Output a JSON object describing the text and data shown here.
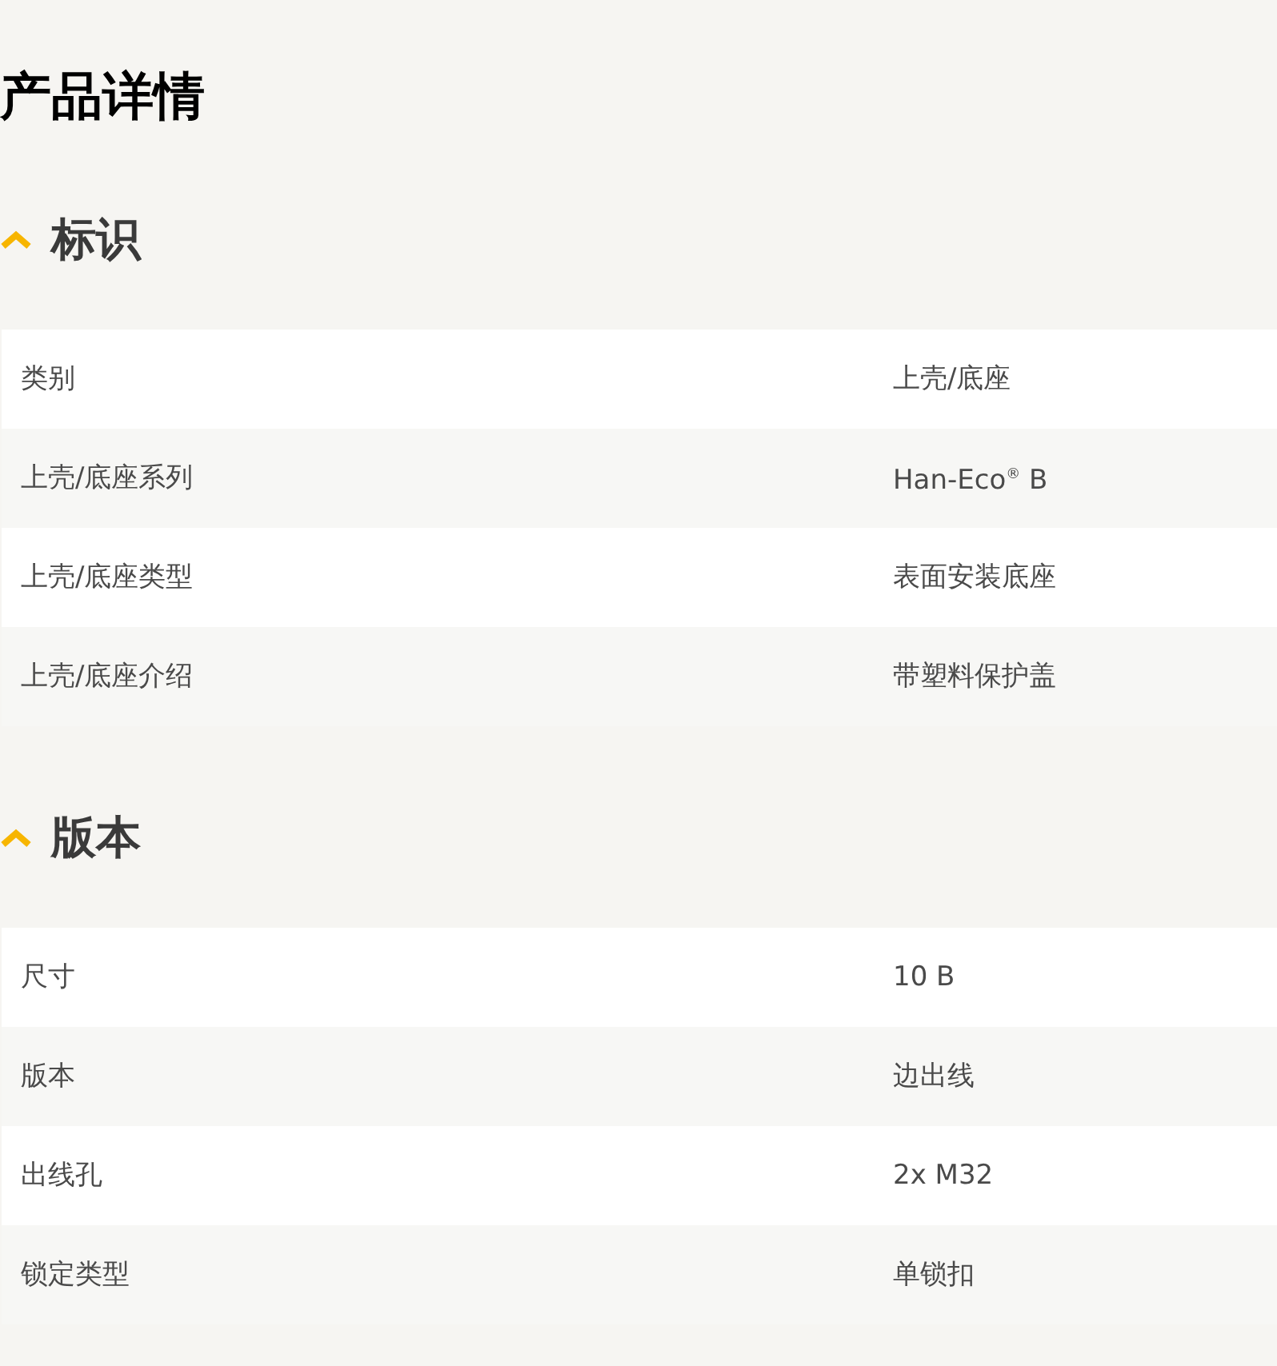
{
  "title": "产品详情",
  "sections": [
    {
      "title": "标识",
      "expanded": true,
      "rows": [
        {
          "label": "类别",
          "value": "上壳/底座"
        },
        {
          "label": "上壳/底座系列",
          "value": "Han-Eco$^{®}$ B"
        },
        {
          "label": "上壳/底座类型",
          "value": "表面安装底座"
        },
        {
          "label": "上壳/底座介绍",
          "value": "带塑料保护盖"
        }
      ]
    },
    {
      "title": "版本",
      "expanded": true,
      "rows": [
        {
          "label": "尺寸",
          "value": "10 B"
        },
        {
          "label": "版本",
          "value": "边出线"
        },
        {
          "label": "出线孔",
          "value": "2x M32"
        },
        {
          "label": "锁定类型",
          "value": "单锁扣"
        }
      ]
    }
  ]
}
